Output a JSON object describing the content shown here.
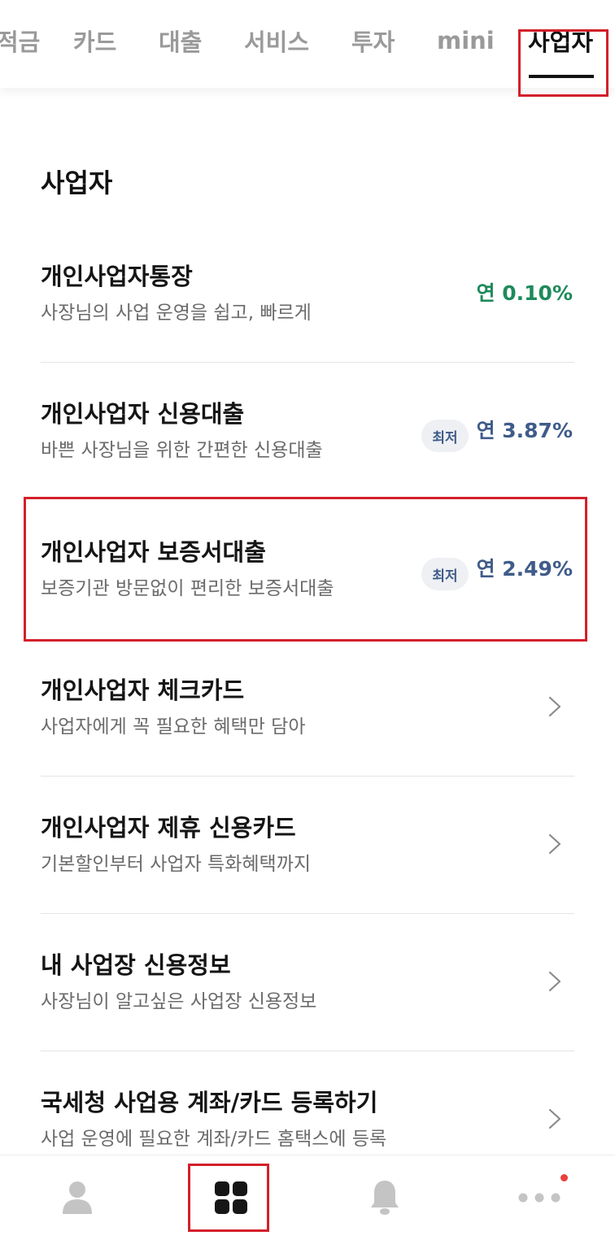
{
  "tabs": [
    {
      "label": "예적금",
      "visible_label": "적금"
    },
    {
      "label": "카드"
    },
    {
      "label": "대출"
    },
    {
      "label": "서비스"
    },
    {
      "label": "투자"
    },
    {
      "label": "mini"
    },
    {
      "label": "사업자",
      "active": true
    }
  ],
  "section_title": "사업자",
  "items": [
    {
      "title": "개인사업자통장",
      "subtitle": "사장님의 사업 운영을 쉽고, 빠르게",
      "rate": "연 0.10%",
      "rate_color": "#1e8a5b"
    },
    {
      "title": "개인사업자 신용대출",
      "subtitle": "바쁜 사장님을 위한 간편한 신용대출",
      "badge": "최저",
      "rate": "연 3.87%",
      "rate_color": "#3f5b8a"
    },
    {
      "title": "개인사업자 보증서대출",
      "subtitle": "보증기관 방문없이 편리한 보증서대출",
      "badge": "최저",
      "rate": "연 2.49%",
      "rate_color": "#3f5b8a"
    },
    {
      "title": "개인사업자 체크카드",
      "subtitle": "사업자에게 꼭 필요한 혜택만 담아"
    },
    {
      "title": "개인사업자 제휴 신용카드",
      "subtitle": "기본할인부터 사업자 특화혜택까지"
    },
    {
      "title": "내 사업장 신용정보",
      "subtitle": "사장님이 알고싶은 사업장 신용정보"
    },
    {
      "title": "국세청 사업용 계좌/카드 등록하기",
      "subtitle": "사업 운영에 필요한 계좌/카드 홈택스에 등록"
    }
  ],
  "bottom_nav": [
    {
      "icon": "person-icon"
    },
    {
      "icon": "grid-icon",
      "active": true
    },
    {
      "icon": "bell-icon"
    },
    {
      "icon": "more-icon",
      "notification_dot": true
    }
  ],
  "colors": {
    "highlight": "#d3202a",
    "green": "#1e8a5b",
    "blue": "#3f5b8a"
  }
}
